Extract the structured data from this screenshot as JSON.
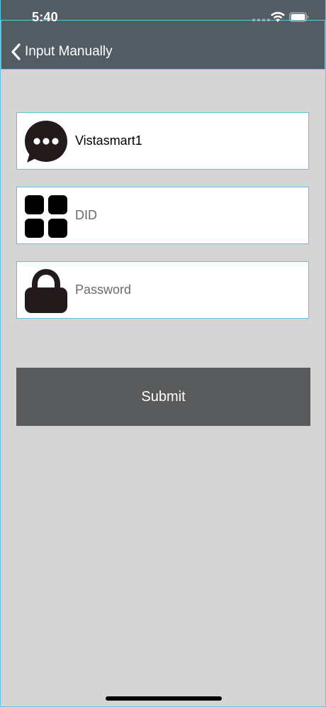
{
  "status_bar": {
    "time": "5:40",
    "signal_icon": "cellular-signal-icon",
    "wifi_icon": "wifi-icon",
    "battery_icon": "battery-icon"
  },
  "nav": {
    "back_icon": "chevron-left-icon",
    "title": "Input Manually"
  },
  "form": {
    "name_field": {
      "icon": "chat-bubble-icon",
      "value": "Vistasmart1"
    },
    "did_field": {
      "icon": "grid-icon",
      "placeholder": "DID",
      "value": ""
    },
    "password_field": {
      "icon": "lock-icon",
      "placeholder": "Password",
      "value": ""
    },
    "submit_label": "Submit"
  },
  "colors": {
    "nav_background": "#525c62",
    "page_background": "#d6d5d6",
    "button_background": "#595a5b",
    "field_border": "#5ec4e6"
  }
}
